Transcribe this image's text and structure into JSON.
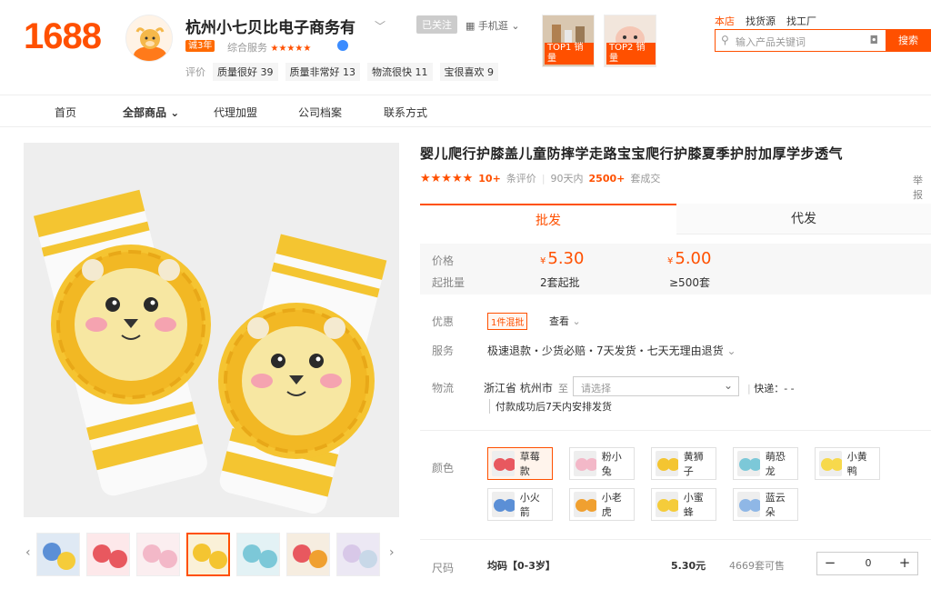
{
  "header": {
    "logo": "1688",
    "shop_name": "杭州小七贝比电子商务有",
    "year_badge": "诚3年",
    "combined_label": "综合服务",
    "combined_stars": "★★★★★",
    "follow_label": "已关注",
    "mobile_label": "手机逛",
    "eval_label": "评价",
    "evals": [
      {
        "label": "质量很好",
        "count": "39"
      },
      {
        "label": "质量非常好",
        "count": "13"
      },
      {
        "label": "物流很快",
        "count": "11"
      },
      {
        "label": "宝很喜欢",
        "count": "9"
      }
    ],
    "top_products": [
      {
        "label": "TOP1 销量"
      },
      {
        "label": "TOP2 销量"
      }
    ],
    "search_tabs": [
      "本店",
      "找货源",
      "找工厂"
    ],
    "search_placeholder": "输入产品关键词",
    "search_button": "搜索"
  },
  "nav": {
    "items": [
      "首页",
      "全部商品",
      "代理加盟",
      "公司档案",
      "联系方式"
    ]
  },
  "product": {
    "title": "婴儿爬行护膝盖儿童防摔学走路宝宝爬行护膝夏季护肘加厚学步透气",
    "stars": "★★★★★",
    "review_count": "10+",
    "review_label": "条评价",
    "sales_prefix": "90天内",
    "sales_count": "2500+",
    "sales_suffix": "套成交",
    "report_label": "举报",
    "tabs": [
      "批发",
      "代发"
    ],
    "price_label": "价格",
    "minq_label": "起批量",
    "tiers": [
      {
        "currency": "¥",
        "price": "5.30",
        "min": "2套起批"
      },
      {
        "currency": "¥",
        "price": "5.00",
        "min": "≥500套"
      }
    ],
    "promo_label": "优惠",
    "promo_badge": "1件混批",
    "promo_view": "查看",
    "service_label": "服务",
    "service_text": "极速退款・少货必赔・7天发货・七天无理由退货",
    "logistics_label": "物流",
    "origin": "浙江省 杭州市",
    "to_label": "至",
    "dest_placeholder": "请选择",
    "express": "快递：- -",
    "ship_note": "付款成功后7天内安排发货",
    "color_label": "颜色",
    "colors": [
      {
        "name": "草莓款",
        "swatch": "#e8585f"
      },
      {
        "name": "粉小兔",
        "swatch": "#f3b8c8"
      },
      {
        "name": "黄狮子",
        "swatch": "#f4c531"
      },
      {
        "name": "萌恐龙",
        "swatch": "#7cc8d8"
      },
      {
        "name": "小黄鸭",
        "swatch": "#f7d94c"
      },
      {
        "name": "小火箭",
        "swatch": "#5b8fd6"
      },
      {
        "name": "小老虎",
        "swatch": "#f0a030"
      },
      {
        "name": "小蜜蜂",
        "swatch": "#f5cc3a"
      },
      {
        "name": "蓝云朵",
        "swatch": "#8fb7e6"
      }
    ],
    "size_label": "尺码",
    "sku": {
      "name": "均码【0-3岁】",
      "price": "5.30元",
      "stock": "4669套可售",
      "qty": "0"
    }
  }
}
